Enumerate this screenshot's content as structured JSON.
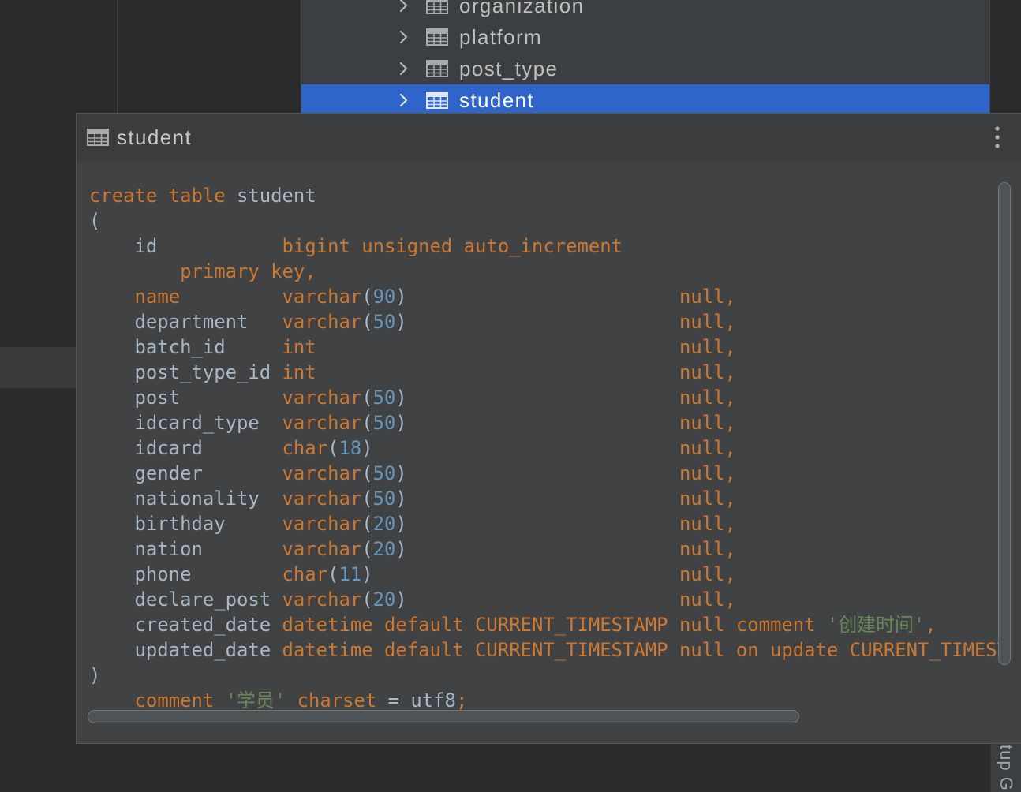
{
  "colors": {
    "keyword": "#cc7832",
    "plain": "#a9b7c6",
    "number": "#6897bb",
    "string": "#6a8759",
    "selection": "#2f65ca"
  },
  "tree": {
    "items": [
      {
        "label": "organization",
        "icon": "table-icon"
      },
      {
        "label": "platform",
        "icon": "table-icon"
      },
      {
        "label": "post_type",
        "icon": "table-icon"
      },
      {
        "label": "student",
        "icon": "table-icon",
        "selected": true
      }
    ]
  },
  "popup": {
    "title": "student",
    "title_icon": "table-icon",
    "menu_icon": "more-vertical-icon"
  },
  "editor": {
    "lines": [
      [
        [
          "create table",
          "#cc7832"
        ],
        [
          " student",
          "#a9b7c6"
        ]
      ],
      [
        [
          "(",
          "#a9b7c6"
        ]
      ],
      [
        [
          "    id           ",
          "#a9b7c6"
        ],
        [
          "bigint unsigned auto_increment",
          "#cc7832"
        ]
      ],
      [
        [
          "        primary key,",
          "#cc7832"
        ]
      ],
      [
        [
          "    ",
          "#a9b7c6"
        ],
        [
          "name         varchar",
          "#cc7832"
        ],
        [
          "(",
          "#a9b7c6"
        ],
        [
          "90",
          "#6897bb"
        ],
        [
          ")                        ",
          "#a9b7c6"
        ],
        [
          "null,",
          "#cc7832"
        ]
      ],
      [
        [
          "    department   ",
          "#a9b7c6"
        ],
        [
          "varchar",
          "#cc7832"
        ],
        [
          "(",
          "#a9b7c6"
        ],
        [
          "50",
          "#6897bb"
        ],
        [
          ")                        ",
          "#a9b7c6"
        ],
        [
          "null,",
          "#cc7832"
        ]
      ],
      [
        [
          "    batch_id     ",
          "#a9b7c6"
        ],
        [
          "int                                null,",
          "#cc7832"
        ]
      ],
      [
        [
          "    post_type_id ",
          "#a9b7c6"
        ],
        [
          "int                                null,",
          "#cc7832"
        ]
      ],
      [
        [
          "    post         ",
          "#a9b7c6"
        ],
        [
          "varchar",
          "#cc7832"
        ],
        [
          "(",
          "#a9b7c6"
        ],
        [
          "50",
          "#6897bb"
        ],
        [
          ")                        ",
          "#a9b7c6"
        ],
        [
          "null,",
          "#cc7832"
        ]
      ],
      [
        [
          "    idcard_type  ",
          "#a9b7c6"
        ],
        [
          "varchar",
          "#cc7832"
        ],
        [
          "(",
          "#a9b7c6"
        ],
        [
          "50",
          "#6897bb"
        ],
        [
          ")                        ",
          "#a9b7c6"
        ],
        [
          "null,",
          "#cc7832"
        ]
      ],
      [
        [
          "    idcard       ",
          "#a9b7c6"
        ],
        [
          "char",
          "#cc7832"
        ],
        [
          "(",
          "#a9b7c6"
        ],
        [
          "18",
          "#6897bb"
        ],
        [
          ")                           ",
          "#a9b7c6"
        ],
        [
          "null,",
          "#cc7832"
        ]
      ],
      [
        [
          "    gender       ",
          "#a9b7c6"
        ],
        [
          "varchar",
          "#cc7832"
        ],
        [
          "(",
          "#a9b7c6"
        ],
        [
          "50",
          "#6897bb"
        ],
        [
          ")                        ",
          "#a9b7c6"
        ],
        [
          "null,",
          "#cc7832"
        ]
      ],
      [
        [
          "    nationality  ",
          "#a9b7c6"
        ],
        [
          "varchar",
          "#cc7832"
        ],
        [
          "(",
          "#a9b7c6"
        ],
        [
          "50",
          "#6897bb"
        ],
        [
          ")                        ",
          "#a9b7c6"
        ],
        [
          "null,",
          "#cc7832"
        ]
      ],
      [
        [
          "    birthday     ",
          "#a9b7c6"
        ],
        [
          "varchar",
          "#cc7832"
        ],
        [
          "(",
          "#a9b7c6"
        ],
        [
          "20",
          "#6897bb"
        ],
        [
          ")                        ",
          "#a9b7c6"
        ],
        [
          "null,",
          "#cc7832"
        ]
      ],
      [
        [
          "    nation       ",
          "#a9b7c6"
        ],
        [
          "varchar",
          "#cc7832"
        ],
        [
          "(",
          "#a9b7c6"
        ],
        [
          "20",
          "#6897bb"
        ],
        [
          ")                        ",
          "#a9b7c6"
        ],
        [
          "null,",
          "#cc7832"
        ]
      ],
      [
        [
          "    phone        ",
          "#a9b7c6"
        ],
        [
          "char",
          "#cc7832"
        ],
        [
          "(",
          "#a9b7c6"
        ],
        [
          "11",
          "#6897bb"
        ],
        [
          ")                           ",
          "#a9b7c6"
        ],
        [
          "null,",
          "#cc7832"
        ]
      ],
      [
        [
          "    declare_post ",
          "#a9b7c6"
        ],
        [
          "varchar",
          "#cc7832"
        ],
        [
          "(",
          "#a9b7c6"
        ],
        [
          "20",
          "#6897bb"
        ],
        [
          ")                        ",
          "#a9b7c6"
        ],
        [
          "null,",
          "#cc7832"
        ]
      ],
      [
        [
          "    created_date ",
          "#a9b7c6"
        ],
        [
          "datetime default CURRENT_TIMESTAMP null comment ",
          "#cc7832"
        ],
        [
          "'创建时间'",
          "#6a8759"
        ],
        [
          ",",
          "#cc7832"
        ]
      ],
      [
        [
          "    updated_date ",
          "#a9b7c6"
        ],
        [
          "datetime default CURRENT_TIMESTAMP null on update CURRENT_TIMEST",
          "#cc7832"
        ]
      ],
      [
        [
          ")",
          "#a9b7c6"
        ]
      ],
      [
        [
          "    ",
          "#a9b7c6"
        ],
        [
          "comment ",
          "#cc7832"
        ],
        [
          "'学员'",
          "#6a8759"
        ],
        [
          " charset ",
          "#cc7832"
        ],
        [
          "= utf8",
          "#a9b7c6"
        ],
        [
          ";",
          "#cc7832"
        ]
      ]
    ]
  },
  "side_stripe": {
    "label": "tup G"
  }
}
